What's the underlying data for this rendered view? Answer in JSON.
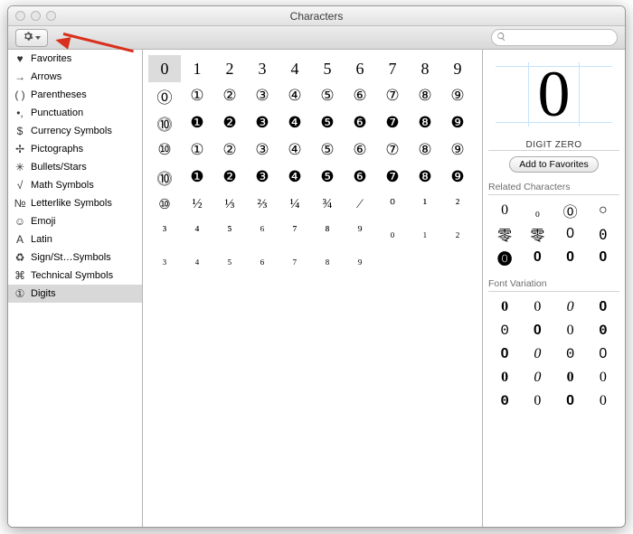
{
  "window_title": "Characters",
  "search": {
    "placeholder": ""
  },
  "sidebar": {
    "items": [
      {
        "icon": "♥",
        "label": "Favorites"
      },
      {
        "icon": "→",
        "label": "Arrows"
      },
      {
        "icon": "( )",
        "label": "Parentheses"
      },
      {
        "icon": "•,",
        "label": "Punctuation"
      },
      {
        "icon": "$",
        "label": "Currency Symbols"
      },
      {
        "icon": "✢",
        "label": "Pictographs"
      },
      {
        "icon": "✳",
        "label": "Bullets/Stars"
      },
      {
        "icon": "√",
        "label": "Math Symbols"
      },
      {
        "icon": "№",
        "label": "Letterlike Symbols"
      },
      {
        "icon": "☺",
        "label": "Emoji"
      },
      {
        "icon": "A",
        "label": "Latin"
      },
      {
        "icon": "♻",
        "label": "Sign/St…Symbols"
      },
      {
        "icon": "⌘",
        "label": "Technical Symbols"
      },
      {
        "icon": "①",
        "label": "Digits"
      }
    ],
    "selected_index": 13
  },
  "char_grid": {
    "rows": [
      [
        "0",
        "1",
        "2",
        "3",
        "4",
        "5",
        "6",
        "7",
        "8",
        "9"
      ],
      [
        "⓪",
        "①",
        "②",
        "③",
        "④",
        "⑤",
        "⑥",
        "⑦",
        "⑧",
        "⑨"
      ],
      [
        "⓾",
        "❶",
        "❷",
        "❸",
        "❹",
        "❺",
        "❻",
        "❼",
        "❽",
        "❾"
      ],
      [
        "⑩",
        "①",
        "②",
        "③",
        "④",
        "⑤",
        "⑥",
        "⑦",
        "⑧",
        "⑨"
      ],
      [
        "⓾",
        "❶",
        "❷",
        "❸",
        "❹",
        "❺",
        "❻",
        "❼",
        "❽",
        "❾"
      ],
      [
        "⑩",
        "½",
        "⅓",
        "⅔",
        "¼",
        "¾",
        "⁄",
        "⁰",
        "¹",
        "²"
      ],
      [
        "³",
        "⁴",
        "⁵",
        "⁶",
        "⁷",
        "⁸",
        "⁹",
        "₀",
        "₁",
        "₂"
      ],
      [
        "₃",
        "₄",
        "₅",
        "₆",
        "₇",
        "₈",
        "₉",
        "",
        "",
        ""
      ]
    ],
    "selected": [
      0,
      0
    ]
  },
  "detail": {
    "glyph": "0",
    "name": "DIGIT ZERO",
    "add_fav_label": "Add to Favorites",
    "related_title": "Related Characters",
    "related": [
      "0",
      "₀",
      "⓪",
      "○",
      "零",
      "零",
      "0",
      "0",
      "⓿",
      "0",
      "0",
      "0"
    ],
    "fontvar_title": "Font Variation",
    "fontvar": [
      "0",
      "0",
      "0",
      "0",
      "0",
      "0",
      "0",
      "0",
      "0",
      "0",
      "0",
      "0",
      "0",
      "0",
      "0",
      "0",
      "0",
      "0",
      "0",
      "0"
    ]
  }
}
